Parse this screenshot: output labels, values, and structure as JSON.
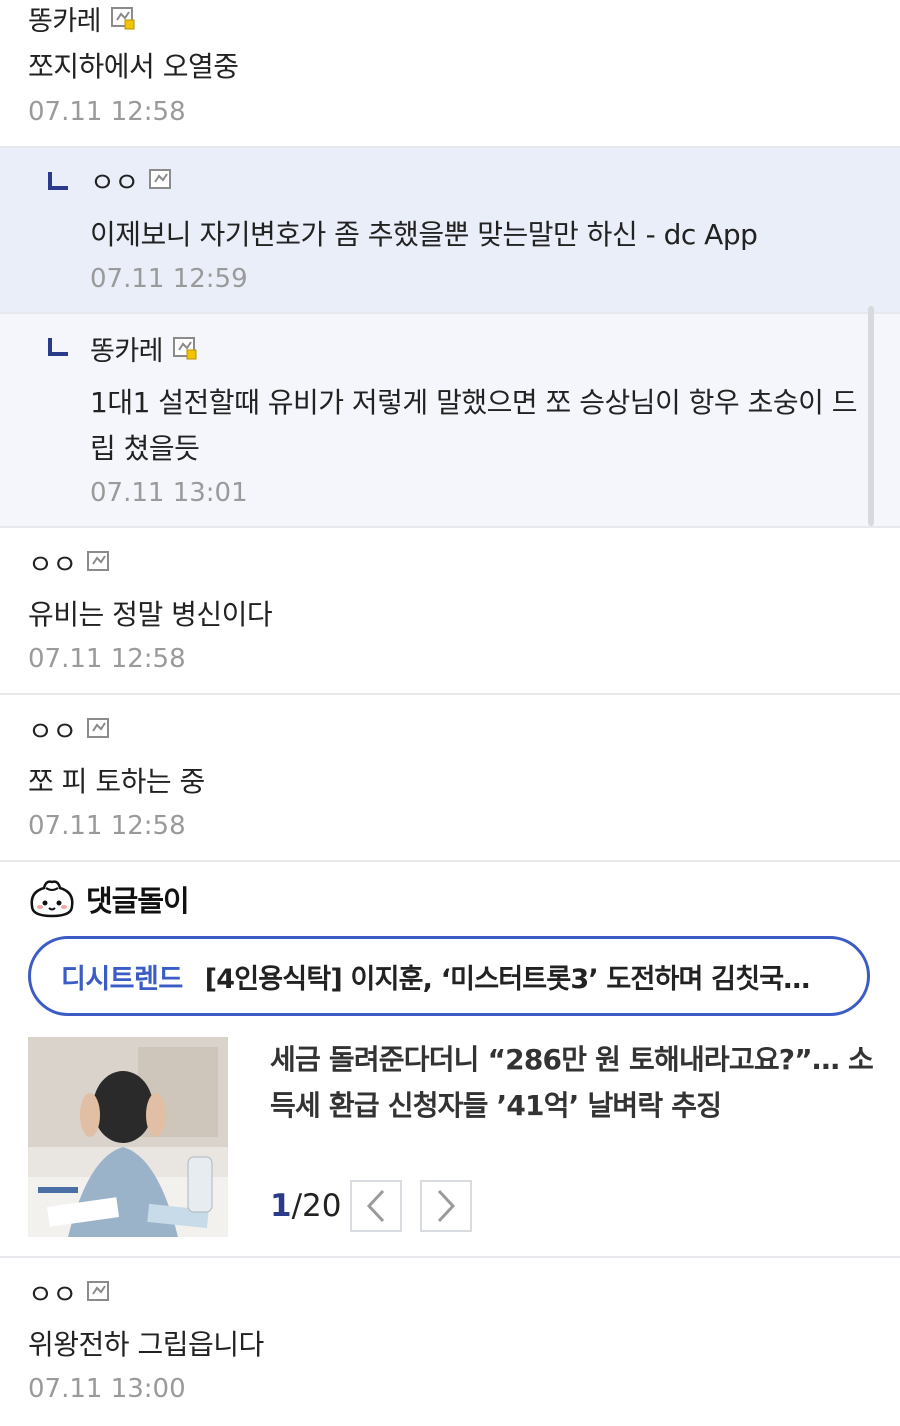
{
  "comments_before": [
    {
      "nick": "똥카레",
      "icon": "gallery-manager-icon",
      "text": "쪼지하에서 오열중",
      "date": "07.11 12:58"
    }
  ],
  "replies": [
    {
      "nick": "ㅇㅇ",
      "icon": "gallery-icon",
      "text": "이제보니 자기변호가 좀 추했을뿐 맞는말만 하신 - dc App",
      "date": "07.11 12:59"
    },
    {
      "nick": "똥카레",
      "icon": "gallery-manager-icon",
      "text": "1대1 설전할때 유비가 저렇게 말했으면 쪼 승상님이 항우 초숭이 드립 쳤을듯",
      "date": "07.11 13:01"
    }
  ],
  "comments_after": [
    {
      "nick": "ㅇㅇ",
      "icon": "gallery-icon",
      "text": "유비는 정말 병신이다",
      "date": "07.11 12:58"
    },
    {
      "nick": "ㅇㅇ",
      "icon": "gallery-icon",
      "text": "쪼 피 토하는 중",
      "date": "07.11 12:58"
    }
  ],
  "ad": {
    "title": "댓글돌이",
    "trend_label": "디시트렌드",
    "trend_text": "[4인용식탁] 이지훈, ‘미스터트롯3’ 도전하며 김칫국…",
    "news_title": "세금 돌려준다더니 “286만 원 토해내라고요?”… 소득세 환급 신청자들 ’41억’ 날벼락 추징",
    "page_current": "1",
    "page_total": "/20",
    "prev_icon": "chevron-left-icon",
    "next_icon": "chevron-right-icon"
  },
  "comments_last": [
    {
      "nick": "ㅇㅇ",
      "icon": "gallery-icon",
      "text": "위왕전하 그립읍니다",
      "date": "07.11 13:00"
    }
  ],
  "colors": {
    "accent": "#3b5cc4",
    "reply_bg": "#f4f6fb",
    "reply_highlight_bg": "#e9eef9",
    "date": "#9a9a9a"
  }
}
